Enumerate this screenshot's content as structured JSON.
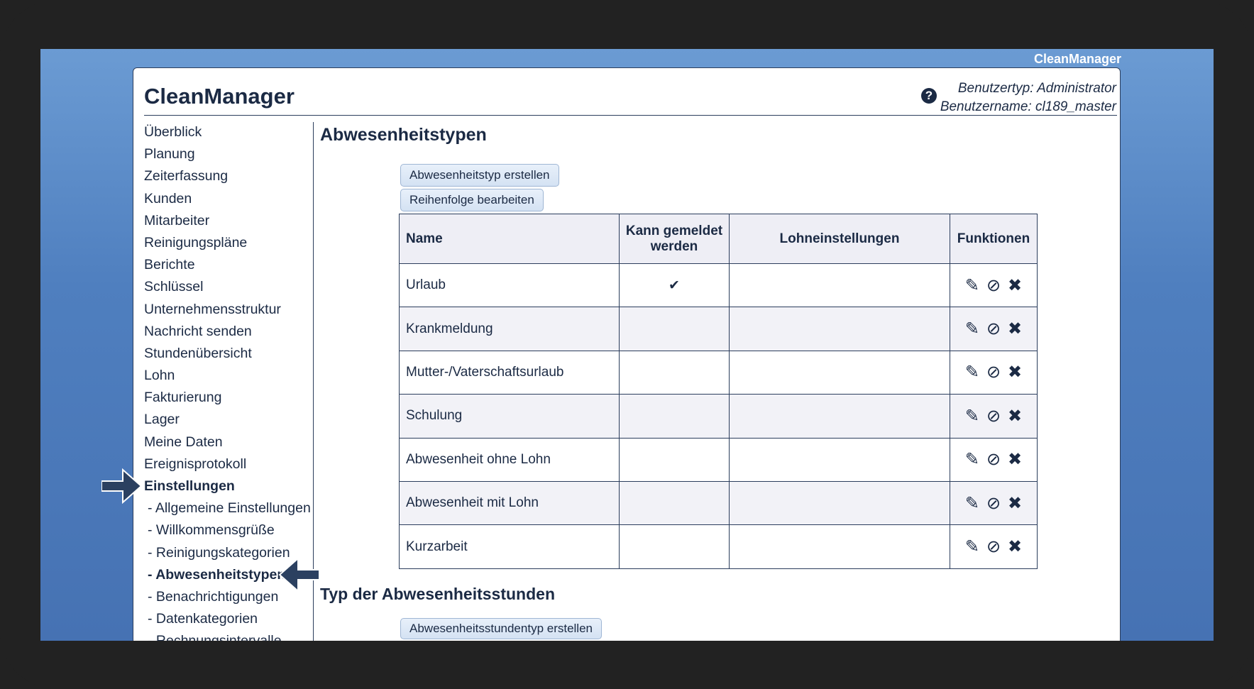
{
  "brand_top": "CleanManager",
  "header": {
    "title": "CleanManager",
    "user_type": "Benutzertyp: Administrator",
    "user_name": "Benutzername: cl189_master",
    "help_icon": "question-circle-icon"
  },
  "sidebar": {
    "items": [
      {
        "label": "Überblick"
      },
      {
        "label": "Planung"
      },
      {
        "label": "Zeiterfassung"
      },
      {
        "label": "Kunden"
      },
      {
        "label": "Mitarbeiter"
      },
      {
        "label": "Reinigungspläne"
      },
      {
        "label": "Berichte"
      },
      {
        "label": "Schlüssel"
      },
      {
        "label": "Unternehmensstruktur"
      },
      {
        "label": "Nachricht senden"
      },
      {
        "label": "Stundenübersicht"
      },
      {
        "label": "Lohn"
      },
      {
        "label": "Fakturierung"
      },
      {
        "label": "Lager"
      },
      {
        "label": "Meine Daten"
      },
      {
        "label": "Ereignisprotokoll"
      },
      {
        "label": "Einstellungen"
      },
      {
        "label": "- Allgemeine Einstellungen"
      },
      {
        "label": "- Willkommensgrüße"
      },
      {
        "label": "- Reinigungskategorien"
      },
      {
        "label": "- Abwesenheitstypen"
      },
      {
        "label": "- Benachrichtigungen"
      },
      {
        "label": "- Datenkategorien"
      },
      {
        "label": "- Rechnungsintervalle"
      }
    ]
  },
  "main": {
    "title": "Abwesenheitstypen",
    "create_button": "Abwesenheitstyp erstellen",
    "order_button": "Reihenfolge bearbeiten",
    "table": {
      "headers": [
        "Name",
        "Kann gemeldet werden",
        "Lohneinstellungen",
        "Funktionen"
      ],
      "rows": [
        {
          "name": "Urlaub",
          "reportable": "✔",
          "wage": ""
        },
        {
          "name": "Krankmeldung",
          "reportable": "",
          "wage": ""
        },
        {
          "name": "Mutter-/Vaterschaftsurlaub",
          "reportable": "",
          "wage": ""
        },
        {
          "name": "Schulung",
          "reportable": "",
          "wage": ""
        },
        {
          "name": "Abwesenheit ohne Lohn",
          "reportable": "",
          "wage": ""
        },
        {
          "name": "Abwesenheit mit Lohn",
          "reportable": "",
          "wage": ""
        },
        {
          "name": "Kurzarbeit",
          "reportable": "",
          "wage": ""
        }
      ],
      "function_icons": [
        "pencil-icon",
        "eye-slash-icon",
        "close-icon"
      ]
    },
    "section2_title": "Typ der Abwesenheitsstunden",
    "create_hours_button": "Abwesenheitsstundentyp erstellen"
  },
  "colors": {
    "accent": "#1b2a44",
    "arrow": "#2b4060",
    "background": "#4f7fbf"
  }
}
